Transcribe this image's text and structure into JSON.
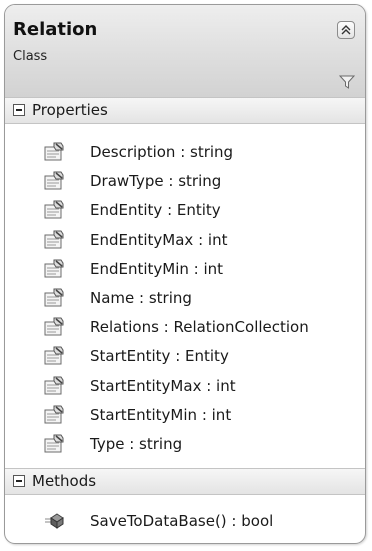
{
  "class_shape": {
    "title": "Relation",
    "subtitle": "Class"
  },
  "properties_section": {
    "label": "Properties",
    "items": [
      {
        "text": "Description : string",
        "icon": "property-icon"
      },
      {
        "text": "DrawType : string",
        "icon": "property-icon"
      },
      {
        "text": "EndEntity : Entity",
        "icon": "property-icon"
      },
      {
        "text": "EndEntityMax : int",
        "icon": "property-icon"
      },
      {
        "text": "EndEntityMin : int",
        "icon": "property-icon"
      },
      {
        "text": "Name : string",
        "icon": "property-icon"
      },
      {
        "text": "Relations : RelationCollection",
        "icon": "property-icon"
      },
      {
        "text": "StartEntity : Entity",
        "icon": "property-icon"
      },
      {
        "text": "StartEntityMax : int",
        "icon": "property-icon"
      },
      {
        "text": "StartEntityMin : int",
        "icon": "property-icon"
      },
      {
        "text": "Type : string",
        "icon": "property-icon"
      }
    ]
  },
  "methods_section": {
    "label": "Methods",
    "items": [
      {
        "text": "SaveToDataBase() : bool",
        "icon": "method-icon"
      }
    ]
  },
  "icons": {
    "collapse": "double-chevron-up-icon",
    "filter": "filter-icon",
    "toggle": "minus-box-icon"
  }
}
